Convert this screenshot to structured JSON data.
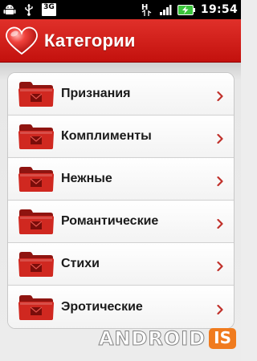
{
  "status_bar": {
    "network_label": "3G",
    "signal_label": "H",
    "time": "19:54",
    "icons": [
      "android-debug-icon",
      "usb-icon",
      "network-3g-icon",
      "data-h-icon",
      "signal-icon",
      "battery-charging-icon"
    ]
  },
  "header": {
    "title": "Категории",
    "icon": "heart-icon"
  },
  "categories": [
    {
      "label": "Признания"
    },
    {
      "label": "Комплименты"
    },
    {
      "label": "Нежные"
    },
    {
      "label": "Романтические"
    },
    {
      "label": "Стихи"
    },
    {
      "label": "Эротические"
    }
  ],
  "watermark": {
    "text": "ANDROID",
    "badge": "IS"
  },
  "colors": {
    "header_red": "#d1201b",
    "folder_red": "#c8231c",
    "chevron_red": "#c0302a",
    "watermark_orange": "#f07b1e"
  }
}
